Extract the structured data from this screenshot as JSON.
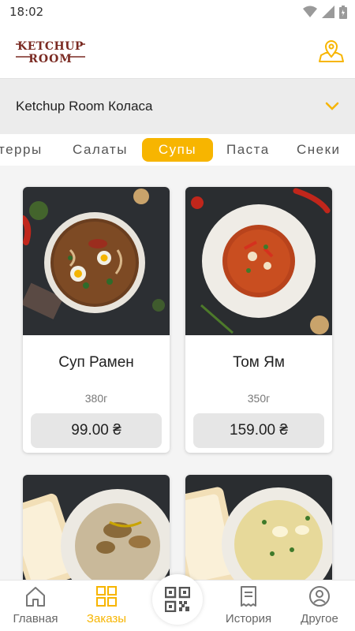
{
  "status_bar": {
    "time": "18:02"
  },
  "header": {
    "logo_text_line1": "KETCHUP",
    "logo_text_line2": "ROOM"
  },
  "restaurant": {
    "name": "Ketchup Room Коласа"
  },
  "categories": [
    {
      "label": "терры",
      "active": false
    },
    {
      "label": "Салаты",
      "active": false
    },
    {
      "label": "Супы",
      "active": true
    },
    {
      "label": "Паста",
      "active": false
    },
    {
      "label": "Снеки",
      "active": false
    }
  ],
  "products": [
    {
      "name": "Суп Рамен",
      "weight": "380г",
      "price": "99.00 ₴"
    },
    {
      "name": "Том Ям",
      "weight": "350г",
      "price": "159.00 ₴"
    },
    {
      "name": "",
      "weight": "",
      "price": ""
    },
    {
      "name": "",
      "weight": "",
      "price": ""
    }
  ],
  "bottom_nav": {
    "home": "Главная",
    "orders": "Заказы",
    "history": "История",
    "other": "Другое"
  },
  "colors": {
    "accent": "#f7b500",
    "logo": "#7a2a22"
  }
}
